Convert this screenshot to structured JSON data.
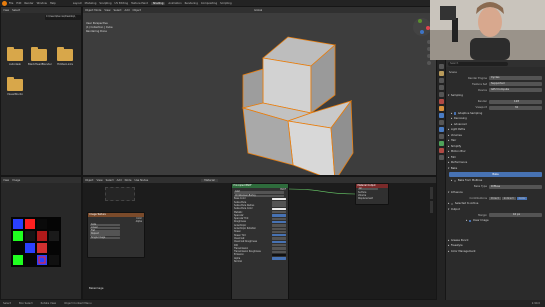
{
  "topbar": {
    "menu": [
      "File",
      "Edit",
      "Render",
      "Window",
      "Help"
    ],
    "workspaces": [
      "Layout",
      "Modeling",
      "Sculpting",
      "UV Editing",
      "Texture Paint",
      "Shading",
      "Animation",
      "Rendering",
      "Compositing",
      "Scripting"
    ],
    "active_workspace": "Shading"
  },
  "file_browser": {
    "header": [
      "View",
      "Select"
    ],
    "path": "C:\\Users\\Dennis\\Desktop\\",
    "folders": [
      "Autodesk",
      "BlackHeadBlender",
      "HiddenLinks",
      "VisualStudio"
    ]
  },
  "viewport": {
    "header": [
      "Object Mode",
      "View",
      "Select",
      "Add",
      "Object"
    ],
    "info": [
      "User Perspective",
      "(1) Collection | Cube",
      "Rendering Done"
    ],
    "shading_label": "Global"
  },
  "properties": {
    "search_placeholder": "Search",
    "object_name": "Scene",
    "render_engine_label": "Render Engine",
    "render_engine": "Cycles",
    "feature_set_label": "Feature Set",
    "feature_set": "Supported",
    "device_label": "Device",
    "device": "GPU Compute",
    "sampling_label": "Sampling",
    "render_label": "Render",
    "render_value": "128",
    "viewport_label": "Viewport",
    "viewport_value": "32",
    "adaptive_sampling": "Adaptive Sampling",
    "denoising": "Denoising",
    "advanced": "Advanced",
    "sections_top": [
      "Light Paths",
      "Volumes",
      "Hair",
      "Simplify",
      "Motion Blur",
      "Film",
      "Performance"
    ],
    "bake_section": "Bake",
    "bake_button": "Bake",
    "bake_from_multires": "Bake from Multires",
    "bake_type_label": "Bake Type",
    "bake_type": "Diffuse",
    "influence": "Influence",
    "contributions": "Contributions",
    "direct": "Direct",
    "indirect": "Indirect",
    "color": "Color",
    "selected_to_active": "Selected to Active",
    "output": "Output",
    "margin_label": "Margin",
    "margin_value": "16 px",
    "clear_image": "Clear Image",
    "sections_bottom": [
      "Grease Pencil",
      "Freestyle",
      "Color Management"
    ]
  },
  "image_editor": {
    "header": [
      "View",
      "Image"
    ]
  },
  "node_editor": {
    "header": [
      "Object",
      "View",
      "Select",
      "Add",
      "Node",
      "Use Nodes"
    ],
    "material_name": "Material",
    "image_node_title": "Image Texture",
    "image_node_rows": [
      "Color",
      "Alpha",
      "bake",
      "Linear",
      "Flat",
      "Repeat",
      "Single Image"
    ],
    "bsdf_title": "Principled BSDF",
    "bsdf_rows": [
      "BSDF",
      "GGX",
      "Christensen-Burley",
      "Base Color",
      "Subsurface",
      "Subsurface Radius",
      "Subsurface Color",
      "Metallic",
      "Specular",
      "Specular Tint",
      "Roughness",
      "Anisotropic",
      "Anisotropic Rotation",
      "Sheen",
      "Sheen Tint",
      "Clearcoat",
      "Clearcoat Roughness",
      "IOR",
      "Transmission",
      "Transmission Roughness",
      "Emission",
      "Alpha",
      "Normal"
    ],
    "output_title": "Material Output",
    "output_rows": [
      "All",
      "Surface",
      "Volume",
      "Displacement"
    ],
    "label_bottom": "Bakeimage"
  },
  "statusbar": {
    "items": [
      "Select",
      "Box Select",
      "Rotate View",
      "Object Context Menu"
    ],
    "version": "2.90.0"
  },
  "colors": {
    "accent_blue": "#4772b3",
    "selection_orange": "#e87d0d",
    "folder": "#d8a74a"
  }
}
